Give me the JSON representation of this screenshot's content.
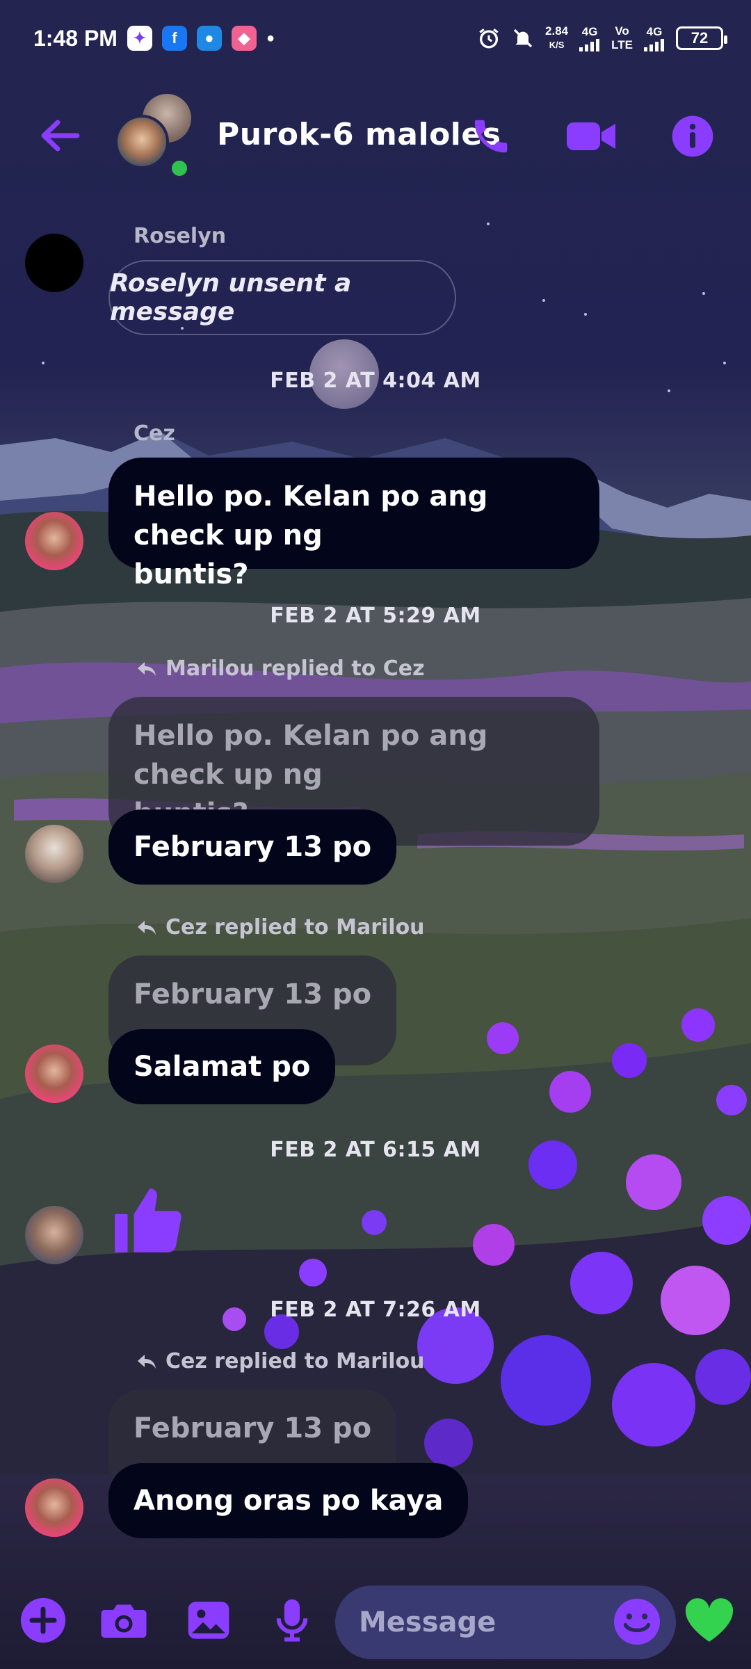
{
  "status_bar": {
    "time": "1:48 PM",
    "net_speed": "2.84",
    "net_unit": "K/S",
    "net1": "4G",
    "volte_top": "Vo",
    "volte_bottom": "LTE",
    "net2": "4G",
    "battery": "72",
    "app_icons": [
      "messenger-icon",
      "facebook-icon",
      "chat-icon",
      "app-icon"
    ]
  },
  "header": {
    "title": "Purok-6 maloles",
    "online": true
  },
  "thread": {
    "roselyn_name": "Roselyn",
    "unsent_text": "Roselyn unsent a message",
    "ts1": "FEB 2 AT 4:04 AM",
    "cez_name": "Cez",
    "msg1_line1": "Hello po. Kelan po ang check up ng",
    "msg1_line2": "buntis?",
    "ts2": "FEB 2 AT 5:29 AM",
    "reply1_note": "Marilou replied to Cez",
    "reply1_quote_line1": "Hello po. Kelan po ang check up ng",
    "reply1_quote_line2": "buntis?",
    "reply1_msg": "February 13 po",
    "reply2_note": "Cez replied to Marilou",
    "reply2_quote": "February 13 po",
    "reply2_msg": "Salamat po",
    "ts3": "FEB 2 AT 6:15 AM",
    "ts4": "FEB 2 AT 7:26 AM",
    "reply3_note": "Cez replied to Marilou",
    "reply3_quote": "February 13 po",
    "reply3_msg": "Anong oras po kaya"
  },
  "composer": {
    "placeholder": "Message"
  },
  "colors": {
    "accent": "#8b3dff",
    "bubble": "#03051a",
    "heart": "#33d24f"
  }
}
